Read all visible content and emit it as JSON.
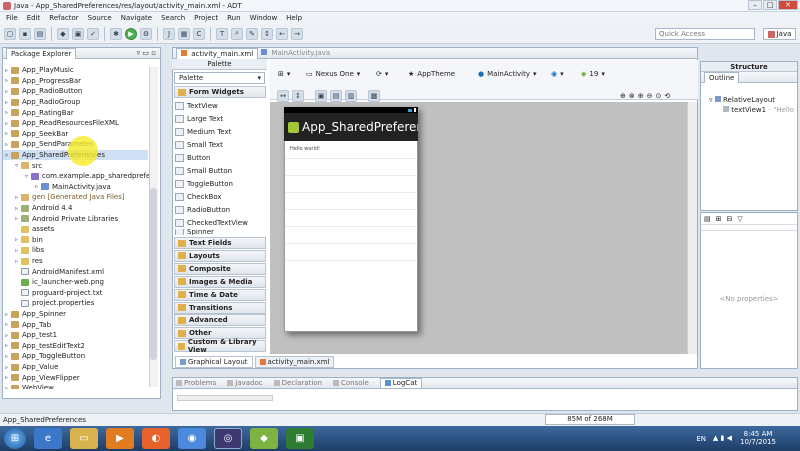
{
  "window": {
    "title": "Java - App_SharedPreferences/res/layout/activity_main.xml - ADT"
  },
  "menu": [
    "File",
    "Edit",
    "Refactor",
    "Source",
    "Navigate",
    "Search",
    "Project",
    "Run",
    "Window",
    "Help"
  ],
  "quick_access": {
    "placeholder": "Quick Access"
  },
  "perspective": {
    "label": "Java"
  },
  "package_explorer": {
    "tab": "Package Explorer",
    "items": [
      {
        "label": "App_PlayMusic",
        "indent": 1,
        "icon": "f-proj"
      },
      {
        "label": "App_ProgressBar",
        "indent": 1,
        "icon": "f-proj"
      },
      {
        "label": "App_RadioButton",
        "indent": 1,
        "icon": "f-proj"
      },
      {
        "label": "App_RadioGroup",
        "indent": 1,
        "icon": "f-proj"
      },
      {
        "label": "App_RatingBar",
        "indent": 1,
        "icon": "f-proj"
      },
      {
        "label": "App_ReadResourcesFileXML",
        "indent": 1,
        "icon": "f-proj"
      },
      {
        "label": "App_SeekBar",
        "indent": 1,
        "icon": "f-proj"
      },
      {
        "label": "App_SendParameter",
        "indent": 1,
        "icon": "f-proj"
      },
      {
        "label": "App_SharedPreferences",
        "indent": 1,
        "icon": "f-proj",
        "selected": true,
        "open": true
      },
      {
        "label": "src",
        "indent": 2,
        "icon": "f-src",
        "open": true
      },
      {
        "label": "com.example.app_sharedprefer",
        "indent": 3,
        "icon": "f-pkg",
        "open": true
      },
      {
        "label": "MainActivity.java",
        "indent": 4,
        "icon": "f-java"
      },
      {
        "label": "gen [Generated Java Files]",
        "indent": 2,
        "icon": "f-src"
      },
      {
        "label": "Android 4.4",
        "indent": 2,
        "icon": "f-lib"
      },
      {
        "label": "Android Private Libraries",
        "indent": 2,
        "icon": "f-lib"
      },
      {
        "label": "assets",
        "indent": 2,
        "icon": "f-folder",
        "noarrow": true
      },
      {
        "label": "bin",
        "indent": 2,
        "icon": "f-folder"
      },
      {
        "label": "libs",
        "indent": 2,
        "icon": "f-folder"
      },
      {
        "label": "res",
        "indent": 2,
        "icon": "f-folder"
      },
      {
        "label": "AndroidManifest.xml",
        "indent": 2,
        "icon": "f-file",
        "noarrow": true
      },
      {
        "label": "ic_launcher-web.png",
        "indent": 2,
        "icon": "f-img",
        "noarrow": true
      },
      {
        "label": "proguard-project.txt",
        "indent": 2,
        "icon": "f-file",
        "noarrow": true
      },
      {
        "label": "project.properties",
        "indent": 2,
        "icon": "f-file",
        "noarrow": true
      },
      {
        "label": "App_Spinner",
        "indent": 1,
        "icon": "f-proj"
      },
      {
        "label": "App_Tab",
        "indent": 1,
        "icon": "f-proj"
      },
      {
        "label": "App_test1",
        "indent": 1,
        "icon": "f-proj"
      },
      {
        "label": "App_testEditText2",
        "indent": 1,
        "icon": "f-proj"
      },
      {
        "label": "App_ToggleButton",
        "indent": 1,
        "icon": "f-proj"
      },
      {
        "label": "App_Value",
        "indent": 1,
        "icon": "f-proj"
      },
      {
        "label": "App_ViewFlipper",
        "indent": 1,
        "icon": "f-proj"
      },
      {
        "label": "WebView",
        "indent": 1,
        "icon": "f-proj"
      }
    ]
  },
  "editor": {
    "tabs": [
      "activity_main.xml",
      "MainActivity.java"
    ],
    "bottom_tabs": [
      "Graphical Layout",
      "activity_main.xml"
    ]
  },
  "palette": {
    "header": "Palette",
    "select": "Palette",
    "form_widgets": "Form Widgets",
    "widgets": [
      "TextView",
      "Large Text",
      "Medium Text",
      "Small Text",
      "Button",
      "Small Button",
      "ToggleButton",
      "CheckBox",
      "RadioButton",
      "CheckedTextView",
      "Spinner"
    ],
    "categories": [
      "Text Fields",
      "Layouts",
      "Composite",
      "Images & Media",
      "Time & Date",
      "Transitions",
      "Advanced",
      "Other",
      "Custom & Library View"
    ]
  },
  "canvas_toolbar": {
    "device": "Nexus One",
    "theme": "AppTheme",
    "activity": "MainActivity",
    "api": "19"
  },
  "device": {
    "app_title": "App_SharedPreferenc",
    "hello": "Hello world!"
  },
  "structure": {
    "header": "Structure",
    "outline": "Outline",
    "root": "RelativeLayout",
    "child": "textView1",
    "child_hint": "- \"Hello"
  },
  "properties": {
    "empty": "<No properties>"
  },
  "console_tabs": [
    "Problems",
    "Javadoc",
    "Declaration",
    "Console",
    "LogCat"
  ],
  "statusbar": {
    "text": "App_SharedPreferences",
    "memory": "85M of 268M"
  },
  "taskbar": {
    "time": "8:45 AM",
    "date": "10/7/2015",
    "lang": "EN"
  }
}
